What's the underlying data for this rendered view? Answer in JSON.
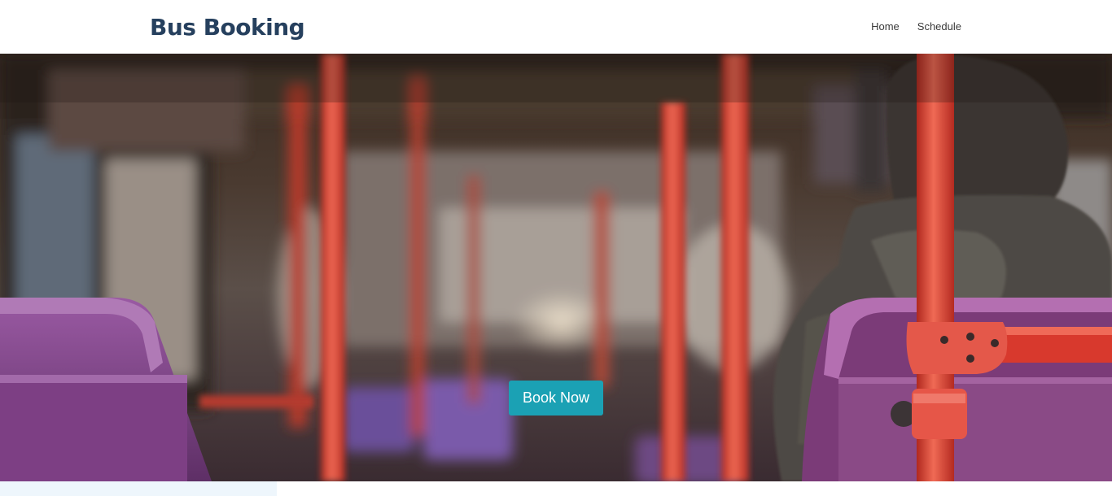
{
  "navbar": {
    "brand": "Bus Booking",
    "links": [
      {
        "label": "Home"
      },
      {
        "label": "Schedule"
      }
    ]
  },
  "hero": {
    "image_description": "Blurred interior of a bus with red poles and purple seats",
    "cta_label": "Book Now"
  },
  "colors": {
    "brand_text": "#26405e",
    "cta_background": "#1ba1b4",
    "pole_red": "#d93a2e",
    "seat_purple": "#8a4a92"
  }
}
